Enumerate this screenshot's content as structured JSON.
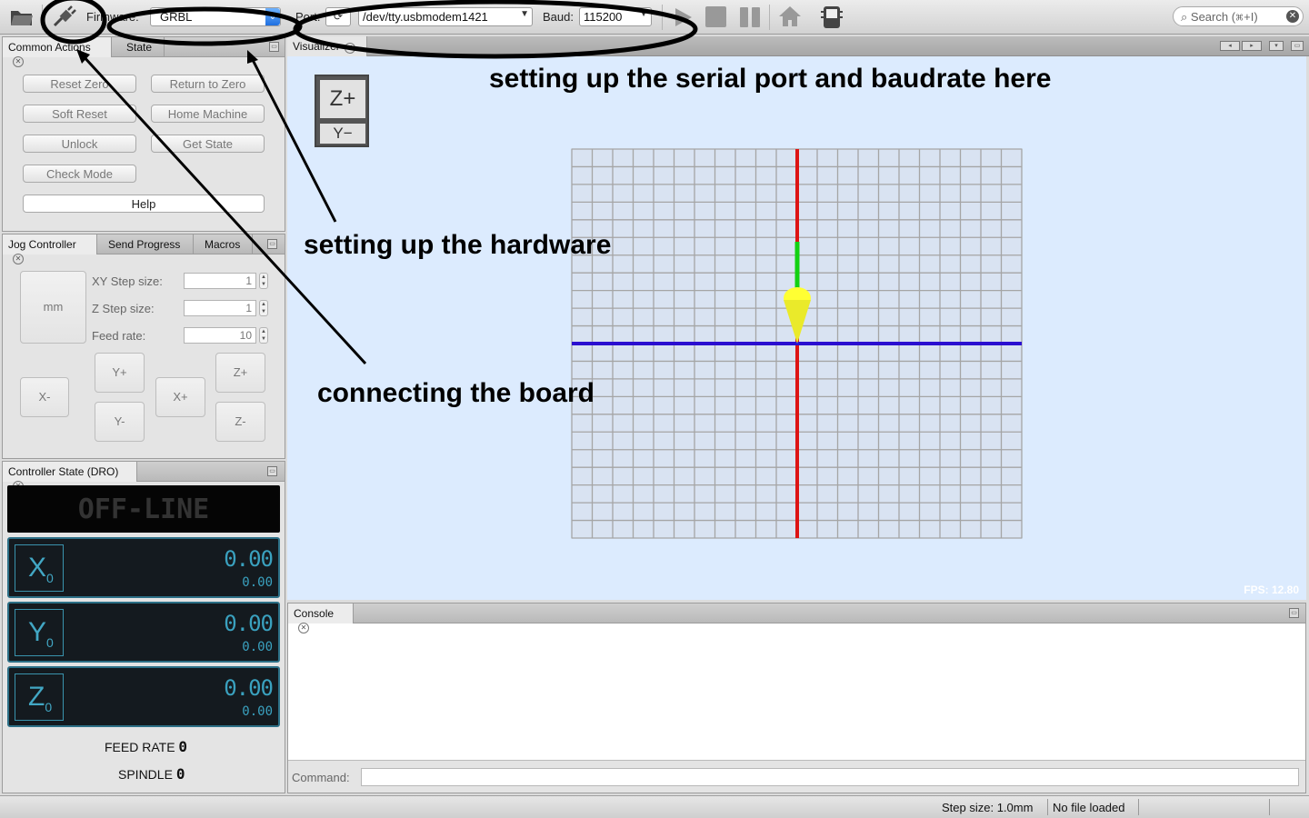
{
  "toolbar": {
    "firmware_label": "Firmware:",
    "firmware_value": "GRBL",
    "port_label": "Port:",
    "port_value": "/dev/tty.usbmodem1421",
    "baud_label": "Baud:",
    "baud_value": "115200",
    "search_placeholder": "Search (⌘+I)"
  },
  "common_actions": {
    "tabs": [
      "Common Actions",
      "State"
    ],
    "buttons": [
      "Reset Zero",
      "Return to Zero",
      "Soft Reset",
      "Home Machine",
      "Unlock",
      "Get State",
      "Check Mode"
    ],
    "help": "Help"
  },
  "jog": {
    "tabs": [
      "Jog Controller",
      "Send Progress",
      "Macros"
    ],
    "units": "mm",
    "xy_step_label": "XY Step size:",
    "xy_step_value": "1",
    "z_step_label": "Z Step size:",
    "z_step_value": "1",
    "feed_label": "Feed rate:",
    "feed_value": "10",
    "buttons": {
      "xminus": "X-",
      "yplus": "Y+",
      "yminus": "Y-",
      "xplus": "X+",
      "zplus": "Z+",
      "zminus": "Z-"
    }
  },
  "dro": {
    "tab": "Controller State (DRO)",
    "status": "OFF-LINE",
    "axes": [
      {
        "name": "X",
        "sub": "0",
        "value": "0.00",
        "secondary": "0.00"
      },
      {
        "name": "Y",
        "sub": "0",
        "value": "0.00",
        "secondary": "0.00"
      },
      {
        "name": "Z",
        "sub": "0",
        "value": "0.00",
        "secondary": "0.00"
      }
    ],
    "feed_rate_label": "FEED RATE",
    "feed_rate_value": "0",
    "spindle_label": "SPINDLE",
    "spindle_value": "0"
  },
  "visualizer": {
    "tab": "Visualizer",
    "view_top": "Z+",
    "view_bottom": "Y−",
    "fps": "FPS: 12.80"
  },
  "annotations": {
    "serial": "setting up the serial port and baudrate here",
    "hardware": "setting up the hardware",
    "board": "connecting the board"
  },
  "console": {
    "tab": "Console",
    "command_label": "Command:"
  },
  "status": {
    "step_size": "Step size: 1.0mm",
    "file": "No file loaded"
  },
  "colors": {
    "viz_bg": "#dcebfe",
    "x_axis": "#2a0fd0",
    "y_axis": "#dd1414",
    "z_axis": "#12d112",
    "tool": "#ffff33"
  }
}
